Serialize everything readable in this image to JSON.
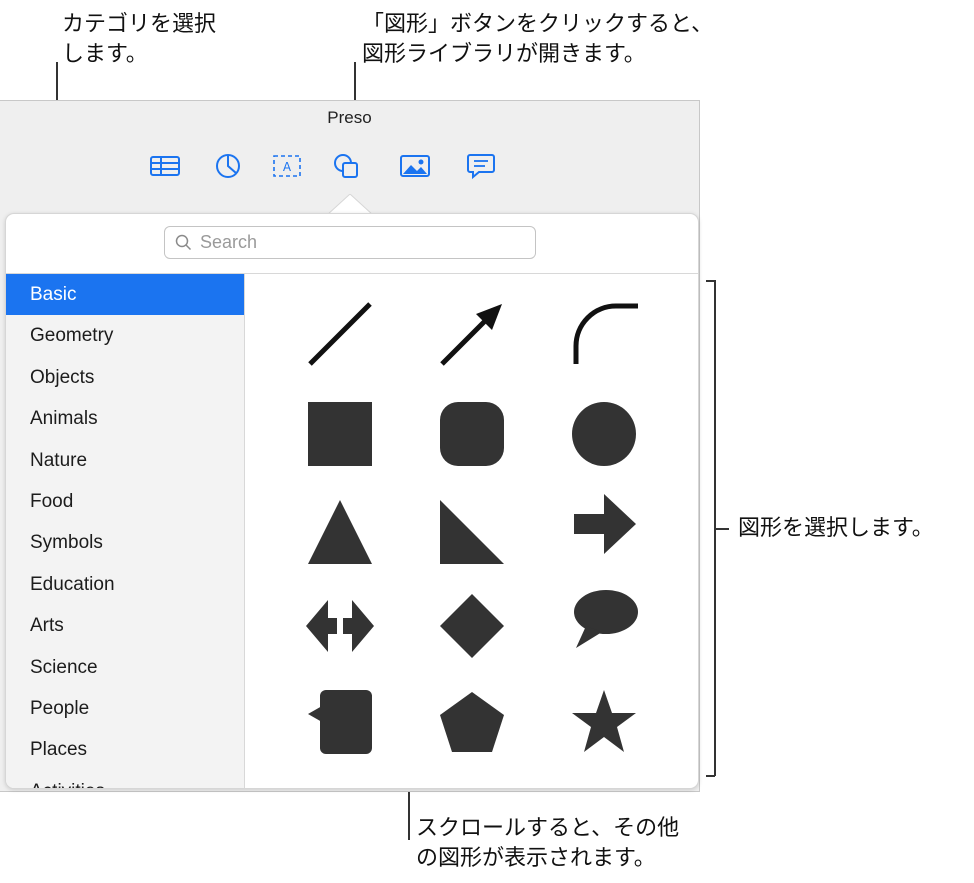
{
  "callouts": {
    "category_top": [
      "カテゴリを選択",
      "します。"
    ],
    "shapes_button": [
      "「図形」ボタンをクリックすると、",
      "図形ライブラリが開きます。"
    ],
    "select_shape": "図形を選択します。",
    "scroll": [
      "スクロールすると、その他",
      "の図形が表示されます。"
    ]
  },
  "window": {
    "title": "Preso",
    "toolbar": [
      {
        "icon": "table-icon"
      },
      {
        "icon": "chart-icon"
      },
      {
        "icon": "text-icon"
      },
      {
        "icon": "shape-icon"
      },
      {
        "icon": "media-icon"
      },
      {
        "icon": "comment-icon"
      }
    ]
  },
  "search": {
    "placeholder": "Search"
  },
  "categories": [
    {
      "label": "Basic",
      "selected": true
    },
    {
      "label": "Geometry"
    },
    {
      "label": "Objects"
    },
    {
      "label": "Animals"
    },
    {
      "label": "Nature"
    },
    {
      "label": "Food"
    },
    {
      "label": "Symbols"
    },
    {
      "label": "Education"
    },
    {
      "label": "Arts"
    },
    {
      "label": "Science"
    },
    {
      "label": "People"
    },
    {
      "label": "Places"
    },
    {
      "label": "Activities"
    }
  ],
  "shapes": [
    "line",
    "arrow-line",
    "curve",
    "square",
    "rounded-square",
    "circle",
    "triangle",
    "right-triangle",
    "arrow",
    "double-arrow",
    "diamond",
    "speech-bubble",
    "callout-square",
    "pentagon",
    "star"
  ],
  "colors": {
    "accent": "#1b74f0",
    "shape_fill": "#333333",
    "toolbar_icon": "#1b74f0"
  }
}
